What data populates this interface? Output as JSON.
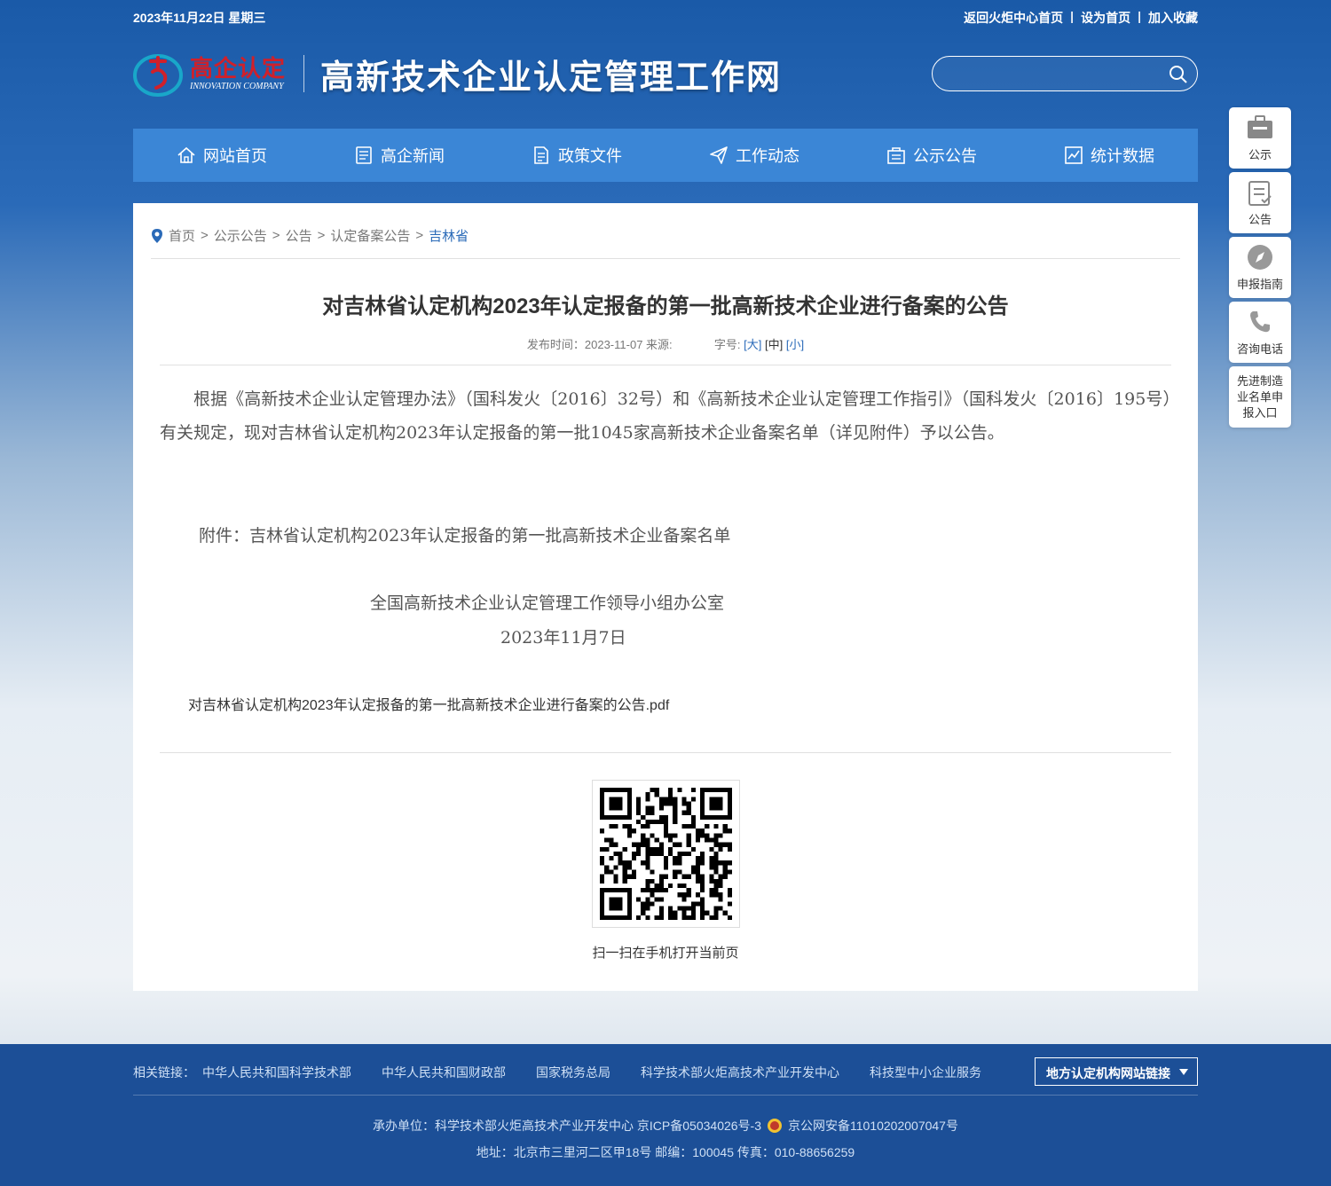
{
  "top": {
    "date": "2023年11月22日 星期三",
    "links": [
      "返回火炬中心首页",
      "设为首页",
      "加入收藏"
    ],
    "sep": "|"
  },
  "brand": {
    "logo_cn": "高企认定",
    "logo_en": "INNOVATION COMPANY",
    "site_title": "高新技术企业认定管理工作网"
  },
  "search": {
    "placeholder": ""
  },
  "nav": [
    "网站首页",
    "高企新闻",
    "政策文件",
    "工作动态",
    "公示公告",
    "统计数据"
  ],
  "side": [
    "公示",
    "公告",
    "申报指南",
    "咨询电话",
    "先进制造业名单申报入口"
  ],
  "crumb": [
    "首页",
    "公示公告",
    "公告",
    "认定备案公告",
    "吉林省"
  ],
  "crumb_sep": ">",
  "article": {
    "title": "对吉林省认定机构2023年认定报备的第一批高新技术企业进行备案的公告",
    "meta_time": "发布时间：2023-11-07 来源:",
    "meta_size": "字号:",
    "size_large": "[大]",
    "size_mid": "[中]",
    "size_small": "[小]",
    "para": "根据《高新技术企业认定管理办法》（国科发火〔2016〕32号）和《高新技术企业认定管理工作指引》（国科发火〔2016〕195号）有关规定，现对吉林省认定机构2023年认定报备的第一批1045家高新技术企业备案名单（详见附件）予以公告。",
    "attachment": "附件：吉林省认定机构2023年认定报备的第一批高新技术企业备案名单",
    "org": "全国高新技术企业认定管理工作领导小组办公室",
    "date": "2023年11月7日",
    "pdf": "对吉林省认定机构2023年认定报备的第一批高新技术企业进行备案的公告.pdf",
    "qr_caption": "扫一扫在手机打开当前页"
  },
  "footer": {
    "links_label": "相关链接：",
    "links": [
      "中华人民共和国科学技术部",
      "中华人民共和国财政部",
      "国家税务总局",
      "科学技术部火炬高技术产业开发中心",
      "科技型中小企业服务"
    ],
    "select": "地方认定机构网站链接",
    "info1a": "承办单位：科学技术部火炬高技术产业开发中心 京ICP备05034026号-3",
    "info1b": "京公网安备11010202007047号",
    "info2": "地址：北京市三里河二区甲18号 邮编：100045 传真：010-88656259"
  },
  "colors": {
    "nav": "#3b86d6",
    "footer": "#1c4f97",
    "accent": "#2a6ab8",
    "logo_red": "#d0202a"
  }
}
